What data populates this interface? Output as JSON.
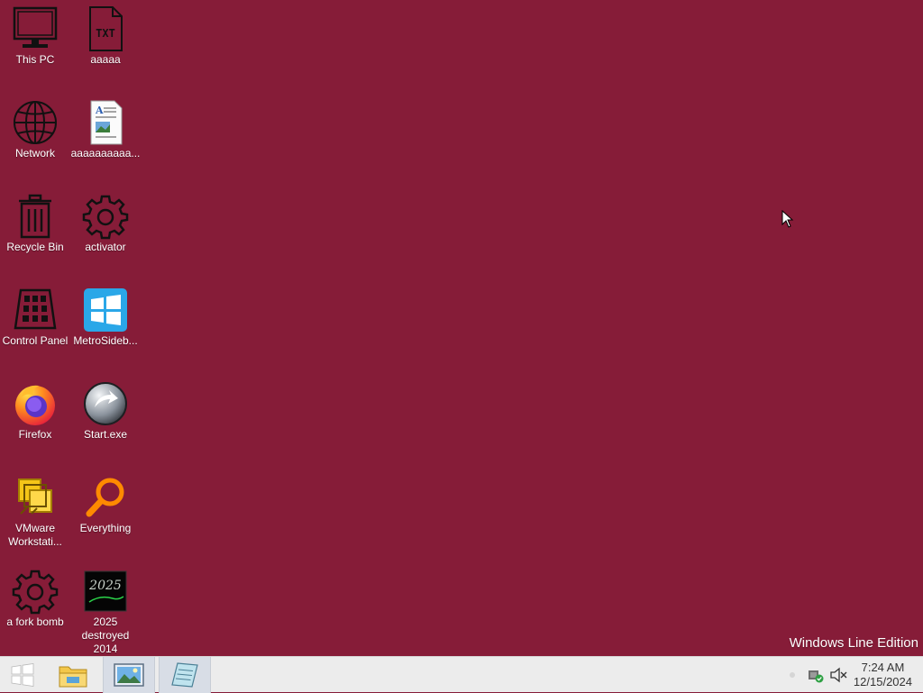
{
  "desktop": {
    "icons": [
      {
        "label": "This PC",
        "icon": "monitor-icon"
      },
      {
        "label": "aaaaa",
        "icon": "text-file-icon"
      },
      {
        "label": "Network",
        "icon": "globe-icon"
      },
      {
        "label": "aaaaaaaaaa...",
        "icon": "document-icon"
      },
      {
        "label": "Recycle Bin",
        "icon": "trash-icon"
      },
      {
        "label": "activator",
        "icon": "gear-icon"
      },
      {
        "label": "Control Panel",
        "icon": "control-panel-icon"
      },
      {
        "label": "MetroSideb...",
        "icon": "windows-tiles-icon"
      },
      {
        "label": "Firefox",
        "icon": "firefox-icon"
      },
      {
        "label": "Start.exe",
        "icon": "start-orb-icon"
      },
      {
        "label": "VMware\nWorkstati...",
        "icon": "vmware-icon"
      },
      {
        "label": "Everything",
        "icon": "magnifier-icon"
      },
      {
        "label": "a fork bomb",
        "icon": "gear-icon"
      },
      {
        "label": "2025\ndestroyed\n2014",
        "icon": "image-thumbnail-icon"
      }
    ],
    "thumbnail_text": "2025",
    "watermark": "Windows Line Edition"
  },
  "taskbar": {
    "buttons": [
      {
        "name": "start-button",
        "icon": "windows-logo-icon"
      },
      {
        "name": "file-explorer-button",
        "icon": "folder-icon"
      },
      {
        "name": "photos-button",
        "icon": "picture-icon"
      },
      {
        "name": "notepad-button",
        "icon": "notepad-icon"
      }
    ],
    "clock": {
      "time": "7:24 AM",
      "date": "12/15/2024"
    }
  },
  "colors": {
    "desktop": "#861c38",
    "taskbar": "#ececec"
  }
}
